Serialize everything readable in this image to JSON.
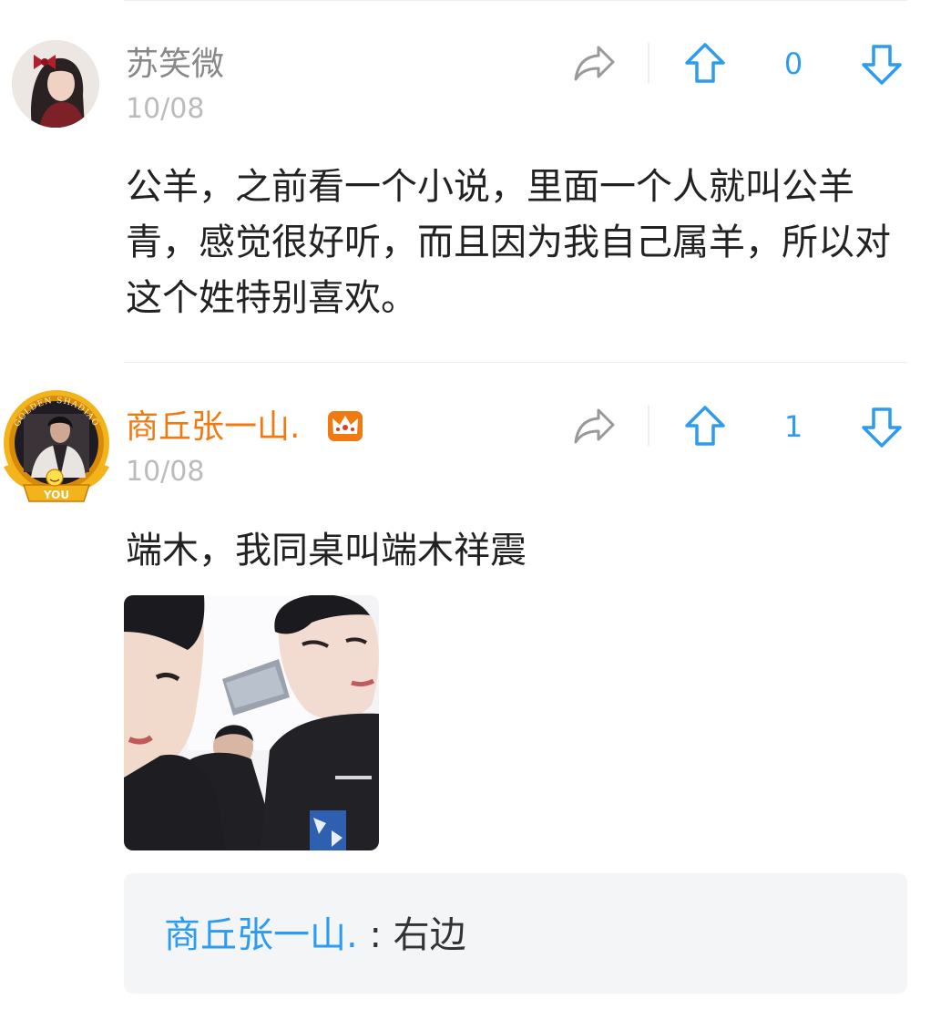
{
  "comments": [
    {
      "username": "苏笑微",
      "date": "10/08",
      "text": "公羊，之前看一个小说，里面一个人就叫公羊青，感觉很好听，而且因为我自己属羊，所以对这个姓特别喜欢。",
      "votes": "0",
      "username_color": "#888888"
    },
    {
      "username": "商丘张一山.",
      "date": "10/08",
      "text": "端木，我同桌叫端木祥震",
      "votes": "1",
      "username_color": "#f07a12",
      "badge_icon": "crown-icon",
      "avatar_frame_text": "GOLDEN SHADIAO",
      "avatar_banner_text": "YOU",
      "reply": {
        "name": "商丘张一山.",
        "separator": ":",
        "text": "右边"
      }
    }
  ],
  "icons": {
    "share": "share-arrow-icon",
    "upvote": "upvote-arrow-icon",
    "downvote": "downvote-arrow-icon"
  },
  "colors": {
    "accent": "#2d9cf0",
    "icon_gray": "#999999",
    "vip_orange": "#f07a12"
  }
}
